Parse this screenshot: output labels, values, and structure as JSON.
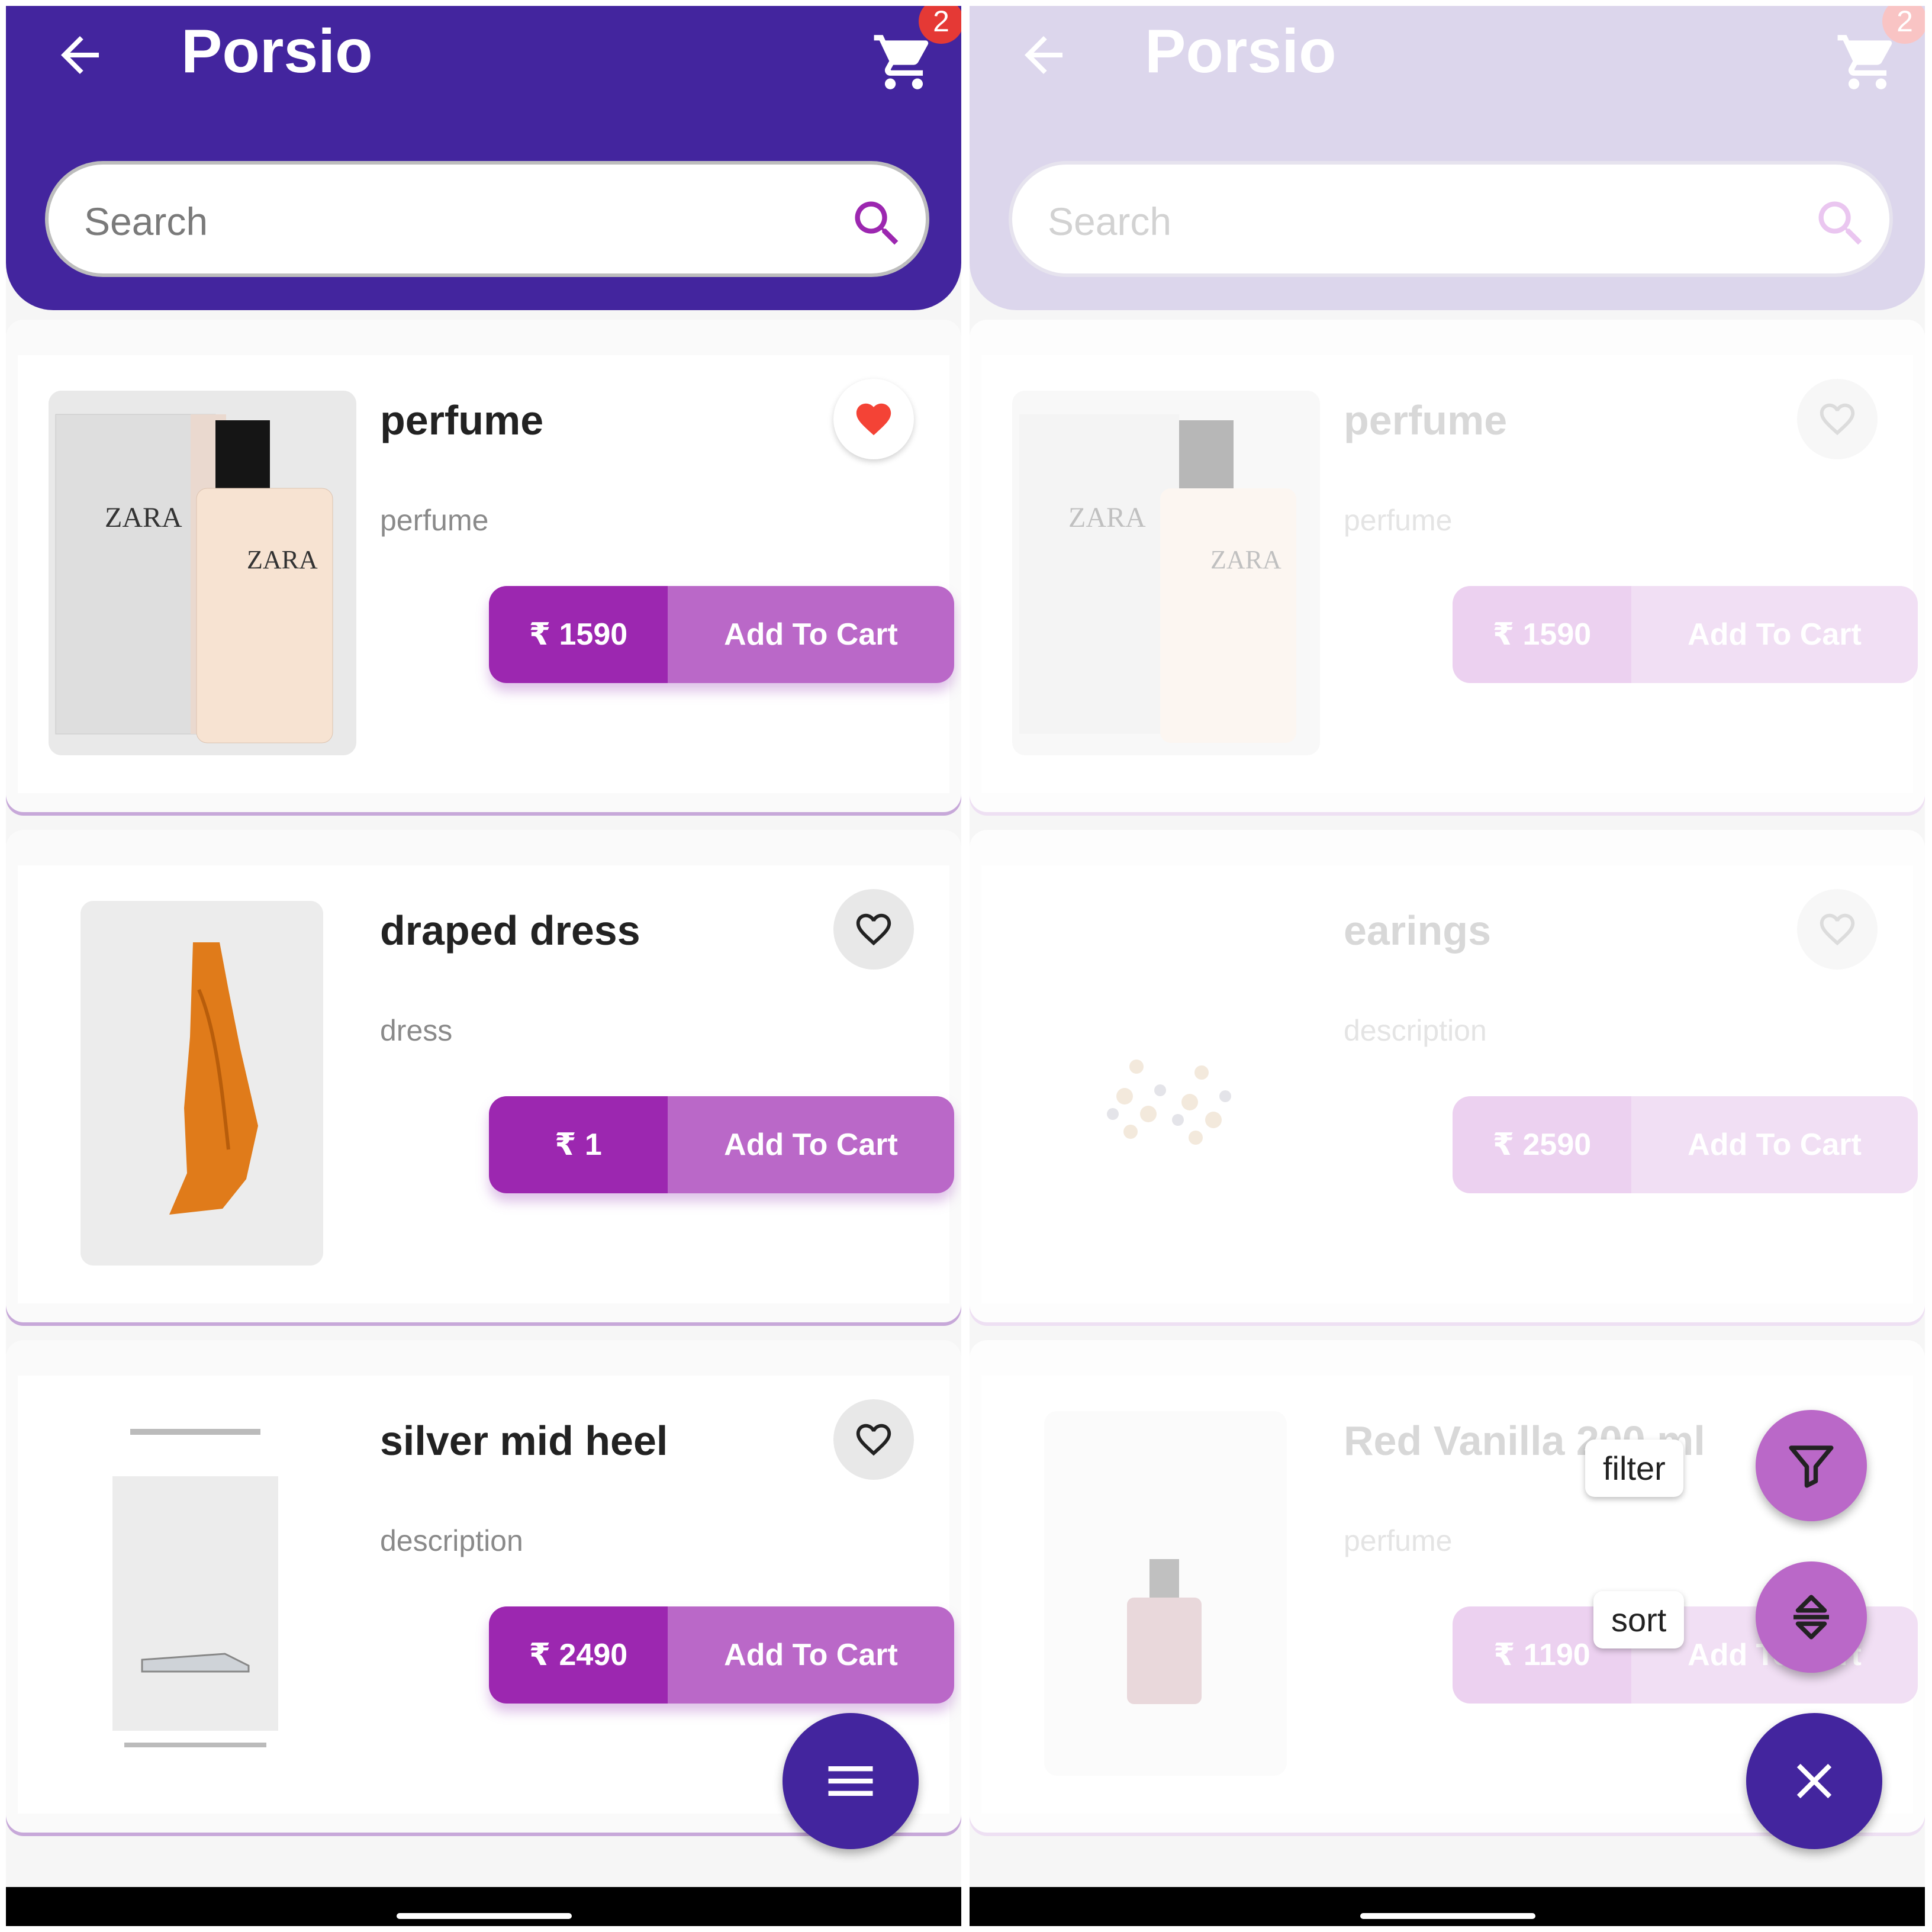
{
  "colors": {
    "primary": "#43259e",
    "accent": "#9c27b0",
    "accent_light": "#ba68c8",
    "badge": "#e53935",
    "heart_active": "#f44336"
  },
  "app": {
    "title": "Porsio",
    "cart_count": "2",
    "search_placeholder": "Search"
  },
  "left_products": [
    {
      "name": "perfume",
      "desc": "perfume",
      "price": "₹ 1590",
      "cta": "Add To Cart",
      "favorite": true,
      "image": "zara-perfume-image"
    },
    {
      "name": "draped dress",
      "desc": "dress",
      "price": "₹ 1",
      "cta": "Add To Cart",
      "favorite": false,
      "image": "orange-dress-image"
    },
    {
      "name": "silver mid heel",
      "desc": "description",
      "price": "₹ 2490",
      "cta": "Add To Cart",
      "favorite": false,
      "image": "shoe-screenshot-image"
    }
  ],
  "right_products": [
    {
      "name": "perfume",
      "desc": "perfume",
      "price": "₹ 1590",
      "cta": "Add To Cart",
      "favorite": false,
      "image": "zara-perfume-image"
    },
    {
      "name": "earings",
      "desc": "description",
      "price": "₹ 2590",
      "cta": "Add To Cart",
      "favorite": false,
      "image": "earrings-image"
    },
    {
      "name": "Red Vanilla 200 ml",
      "desc": "perfume",
      "price": "₹ 1190",
      "cta": "Add To Cart",
      "favorite": false,
      "image": "red-vanilla-bottle-image"
    }
  ],
  "fab_menu": {
    "menu_icon": "hamburger-menu-icon",
    "close_icon": "close-icon",
    "actions": [
      {
        "label": "filter",
        "icon": "filter-funnel-icon"
      },
      {
        "label": "sort",
        "icon": "sort-icon"
      }
    ]
  }
}
